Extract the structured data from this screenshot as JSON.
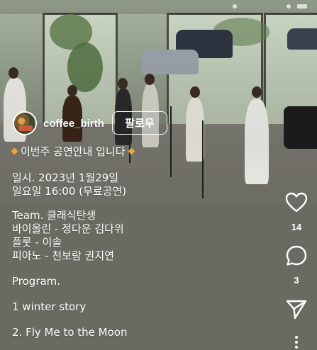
{
  "profile": {
    "username": "coffee_birth",
    "follow_label": "팔로우"
  },
  "caption": {
    "headline": "이번주 공연안내 입니다",
    "lines": [
      "일시.  2023년 1월29일",
      "일요일 16:00 (무료공연)",
      "Team. 클래식탄생",
      "바이올린 - 정다운 김다위",
      "플룻 -  이솔",
      "피아노 -  천보람 권지연",
      "Program.",
      "1  winter story",
      "2. Fly Me to the Moon"
    ]
  },
  "actions": {
    "likes": "14",
    "comments": "3"
  },
  "icons": {
    "like": "heart-icon",
    "comment": "comment-bubble-icon",
    "share": "send-icon",
    "more": "more-vertical-icon",
    "headline_marker": "orange-diamond-icon"
  },
  "colors": {
    "panel": "#6b6a62",
    "text": "#ffffff",
    "diamond": "#f0a33a"
  }
}
